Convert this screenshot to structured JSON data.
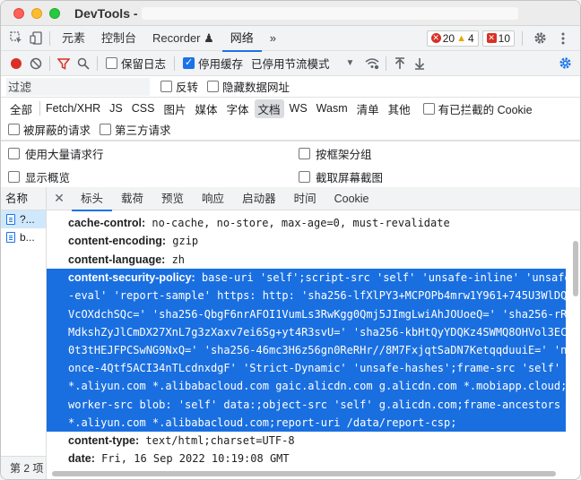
{
  "window": {
    "title": "DevTools -"
  },
  "tabs": [
    {
      "label": "元素"
    },
    {
      "label": "控制台"
    },
    {
      "label": "Recorder ♟"
    },
    {
      "label": "网络"
    }
  ],
  "more_tabs": "»",
  "counts": {
    "errors": "20",
    "warnings": "4",
    "issues": "10"
  },
  "toolbar": {
    "preserve_log": "保留日志",
    "disable_cache": "停用缓存",
    "throttling": "已停用节流模式"
  },
  "filter": {
    "value": "过滤",
    "invert": "反转",
    "hide_data_urls": "隐藏数据网址"
  },
  "types": [
    "全部",
    "Fetch/XHR",
    "JS",
    "CSS",
    "图片",
    "媒体",
    "字体",
    "文档",
    "WS",
    "Wasm",
    "清单",
    "其他"
  ],
  "blocked_cookies": "有已拦截的 Cookie",
  "blocked_requests": "被屏蔽的请求",
  "third_party": "第三方请求",
  "options": {
    "big_rows": "使用大量请求行",
    "group_by_frame": "按框架分组",
    "overview": "显示概览",
    "screenshots": "截取屏幕截图"
  },
  "list": {
    "header": "名称",
    "items": [
      {
        "name": "?..."
      },
      {
        "name": "b..."
      }
    ],
    "footer": "第 2 项"
  },
  "detail_tabs": [
    "标头",
    "载荷",
    "预览",
    "响应",
    "启动器",
    "时间",
    "Cookie"
  ],
  "headers": [
    {
      "key": "cache-control:",
      "value": "no-cache, no-store, max-age=0, must-revalidate"
    },
    {
      "key": "content-encoding:",
      "value": "gzip"
    },
    {
      "key": "content-language:",
      "value": "zh"
    }
  ],
  "csp": {
    "key": "content-security-policy:",
    "lines": [
      "base-uri 'self';script-src 'self' 'unsafe-inline' 'unsafe",
      "-eval' 'report-sample' https: http: 'sha256-lfXlPY3+MCPOPb4mrw1Y961+745U3WlDQ",
      "VcOXdchSQc=' 'sha256-QbgF6nrAFOI1VumLs3RwKgg0Qmj5JImgLwiAhJOUoeQ=' 'sha256-rR",
      "MdkshZyJlCmDX27XnL7g3zXaxv7ei6Sg+yt4R3svU=' 'sha256-kbHtQyYDQKz4SWMQ8OHVol3EC",
      "0t3tHEJFPCSwNG9NxQ=' 'sha256-46mc3H6z56gn0ReRHr//8M7FxjqtSaDN7KetqqduuiE=' 'n",
      "once-4Qtf5ACI34nTLcdnxdgF' 'Strict-Dynamic' 'unsafe-hashes';frame-src 'self'",
      "*.aliyun.com *.alibabacloud.com gaic.alicdn.com g.alicdn.com *.mobiapp.cloud;",
      "worker-src blob: 'self' data:;object-src 'self' g.alicdn.com;frame-ancestors",
      "*.aliyun.com *.alibabacloud.com;report-uri /data/report-csp;"
    ]
  },
  "headers_after": [
    {
      "key": "content-type:",
      "value": "text/html;charset=UTF-8"
    },
    {
      "key": "date:",
      "value": "Fri, 16 Sep 2022 10:19:08 GMT"
    }
  ],
  "colors": {
    "accent": "#1a73e8",
    "selection": "#1a6fe0"
  }
}
